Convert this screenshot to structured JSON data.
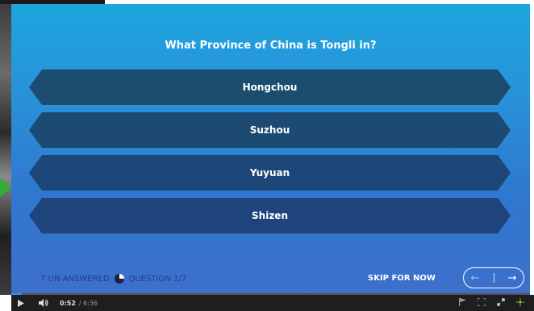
{
  "quiz": {
    "question": "What Province of China is Tongli in?",
    "answers": [
      "Hongchou",
      "Suzhou",
      "Yuyuan",
      "Shizen"
    ],
    "unanswered": "7 UN-ANSWERED",
    "question_counter": "QUESTION 1/7",
    "skip_label": "SKIP FOR NOW",
    "prev_label": "←",
    "next_label": "→"
  },
  "player": {
    "current_time": "0:52",
    "duration": "/ 6:36",
    "play_icon": "play-icon",
    "volume_icon": "volume-icon",
    "progress_fraction": 0.02
  },
  "colors": {
    "accent": "#2b9fe0",
    "answer_bg": "#1c4a72"
  }
}
